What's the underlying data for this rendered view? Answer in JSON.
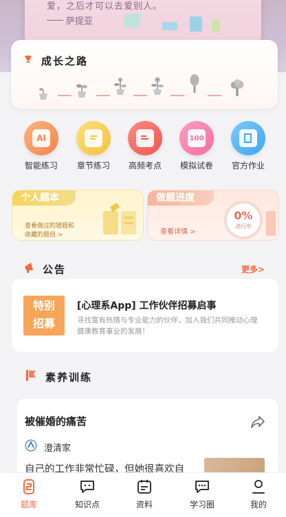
{
  "banner": {
    "quote": "爱，之后才可以去爱别人。",
    "author": "萨提亚"
  },
  "growth": {
    "title": "成长之路"
  },
  "features": [
    {
      "label": "智能练习",
      "icon": "ai-icon",
      "glyph": "AI",
      "color": "#f4844c"
    },
    {
      "label": "章节练习",
      "icon": "book-icon",
      "glyph": "",
      "color": "#f3c23c"
    },
    {
      "label": "高频考点",
      "icon": "hot-points-icon",
      "glyph": "",
      "color": "#f1564e"
    },
    {
      "label": "模拟试卷",
      "icon": "exam-paper-icon",
      "glyph": "100",
      "color": "#f16e9c"
    },
    {
      "label": "官方作业",
      "icon": "homework-icon",
      "glyph": "",
      "color": "#3fa7ef"
    }
  ],
  "question_book": {
    "title": "个人题本",
    "desc_line1": "查看做过的错题和",
    "desc_line2": "收藏的题目 >"
  },
  "progress": {
    "title": "做题进度",
    "link": "查看详情 >",
    "percent": "0%",
    "status": "进行中",
    "value": 0
  },
  "announcement": {
    "section_title": "公告",
    "more": "更多>",
    "image_line1": "特别",
    "image_line2": "招募",
    "title": "[心理系App] 工作伙伴招募启事",
    "desc": "寻找富有热情与专业能力的伙伴，加入我们共同推动心理健康教育事业的发展！"
  },
  "training": {
    "section_title": "素养训练",
    "article": {
      "title": "被催婚的痛苦",
      "author": "澄清家",
      "excerpt": "自己的工作非常忙碌，但她很喜欢自"
    }
  },
  "nav": [
    {
      "label": "题库",
      "icon": "question-bank-icon",
      "active": true
    },
    {
      "label": "知识点",
      "icon": "knowledge-icon",
      "active": false
    },
    {
      "label": "资料",
      "icon": "materials-icon",
      "active": false
    },
    {
      "label": "学习圈",
      "icon": "study-circle-icon",
      "active": false
    },
    {
      "label": "我的",
      "icon": "profile-icon",
      "active": false
    }
  ],
  "colors": {
    "accent": "#f26a3f",
    "nav_active": "#f26a3f"
  }
}
